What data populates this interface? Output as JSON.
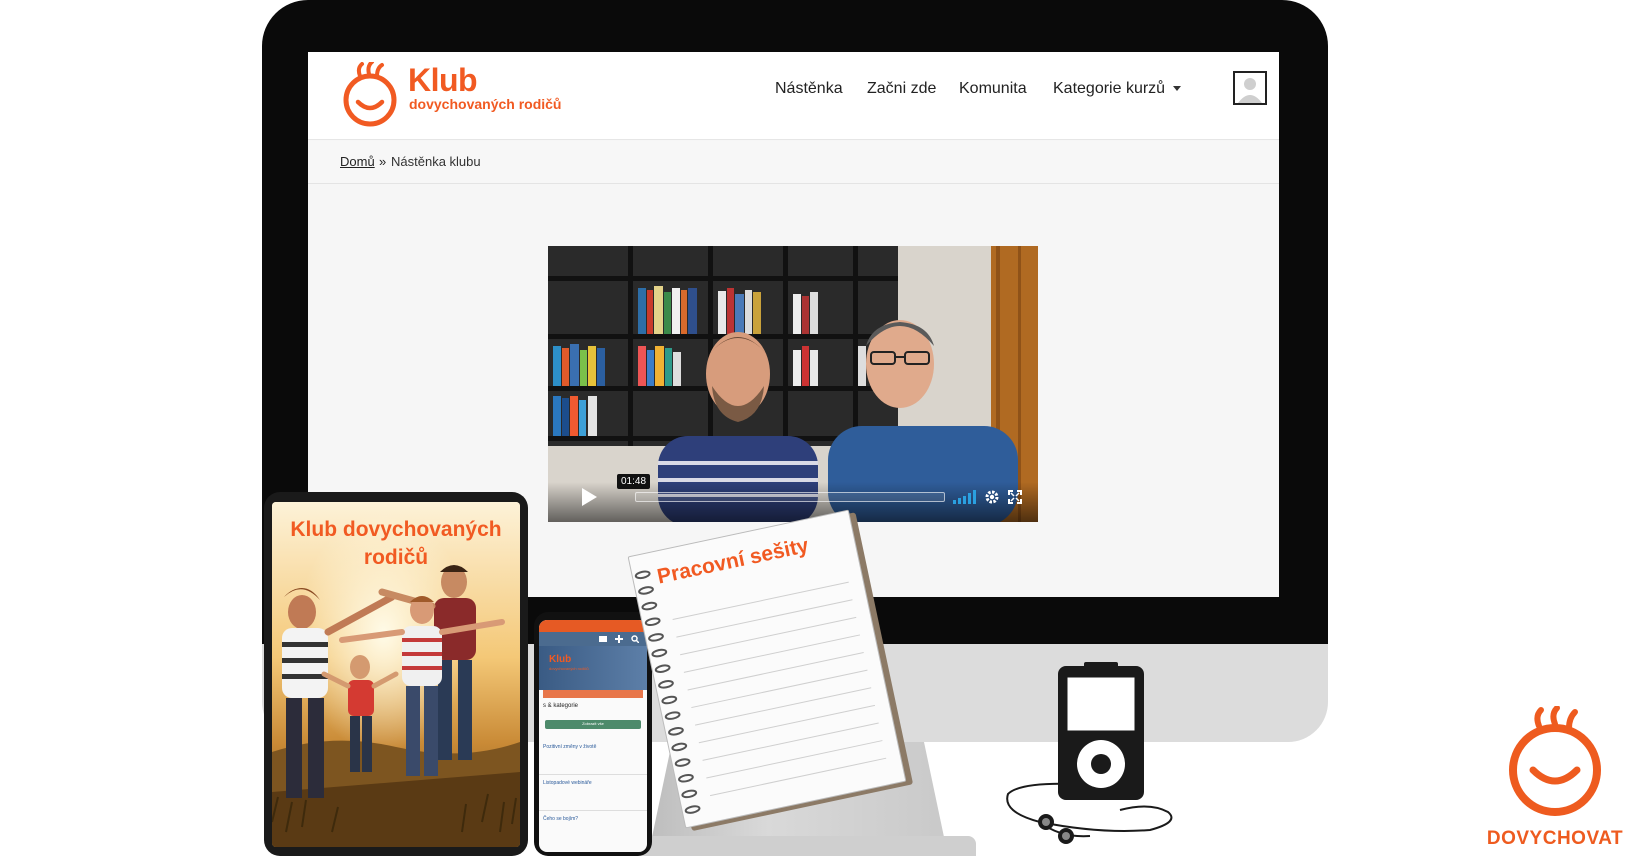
{
  "site": {
    "logo_title": "Klub",
    "logo_subtitle": "dovychovaných rodičů",
    "nav": {
      "dashboard": "Nástěnka",
      "start_here": "Začni zde",
      "community": "Komunita",
      "course_categories": "Kategorie kurzů"
    },
    "breadcrumb": {
      "home": "Domů",
      "separator": "»",
      "current": "Nástěnka klubu"
    }
  },
  "video": {
    "time": "01:48"
  },
  "tablet": {
    "title": "Klub dovychovaných rodičů"
  },
  "phone": {
    "logo_title": "Klub",
    "logo_subtitle": "dovychovaných rodičů",
    "section_label": "s & kategorie",
    "button_label": "Zobrazit vše",
    "items": [
      {
        "title": "Pozitivní změny v životě"
      },
      {
        "title": "Listopadové webináře"
      },
      {
        "title": "Čeho se bojím?"
      }
    ]
  },
  "notebook": {
    "title": "Pracovní sešity"
  },
  "brand": {
    "label": "DOVYCHOVAT"
  },
  "colors": {
    "brand_orange": "#f15a22"
  }
}
